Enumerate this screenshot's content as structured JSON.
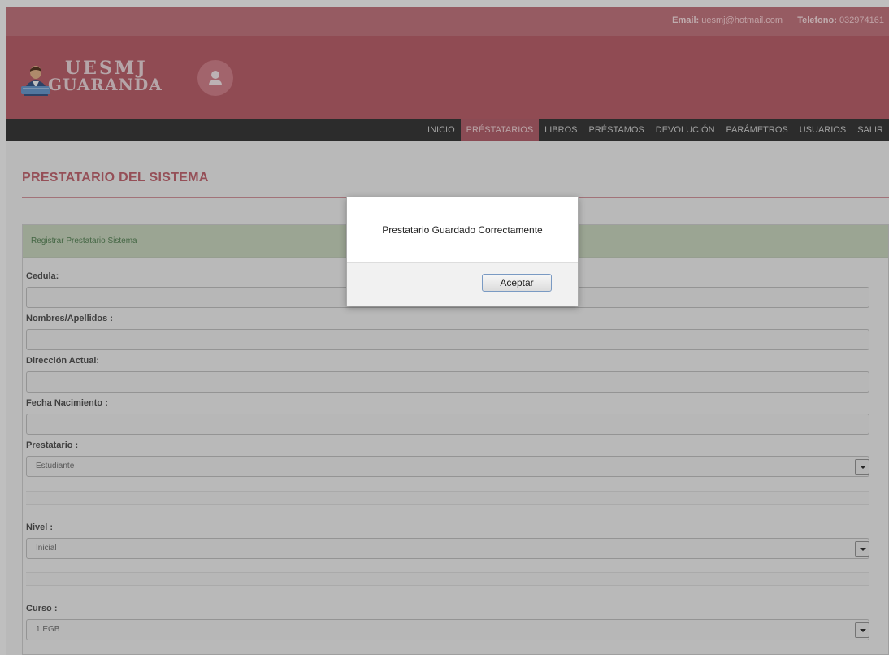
{
  "topbar": {
    "email_label": "Email:",
    "email": "uesmj@hotmail.com",
    "phone_label": "Telefono:",
    "phone": "032974161"
  },
  "brand": {
    "line1": "UESMJ",
    "line2": "GUARANDA"
  },
  "nav": {
    "items": [
      {
        "label": "INICIO"
      },
      {
        "label": "PRÉSTATARIOS"
      },
      {
        "label": "LIBROS"
      },
      {
        "label": "PRÉSTAMOS"
      },
      {
        "label": "DEVOLUCIÓN"
      },
      {
        "label": "PARÁMETROS"
      },
      {
        "label": "USUARIOS"
      },
      {
        "label": "SALIR"
      }
    ],
    "active": "PRÉSTATARIOS"
  },
  "page": {
    "title": "PRESTATARIO DEL SISTEMA"
  },
  "form": {
    "panel_title": "Registrar Prestatario Sistema",
    "cedula_label": "Cedula:",
    "cedula_value": "",
    "nombres_label": "Nombres/Apellidos :",
    "nombres_value": "",
    "direccion_label": "Dirección Actual:",
    "direccion_value": "",
    "fecha_label": "Fecha Nacimiento :",
    "fecha_value": "",
    "prestatario_label": "Prestatario :",
    "prestatario_value": "Estudiante",
    "nivel_label": "Nivel :",
    "nivel_value": "Inicial",
    "curso_label": "Curso :",
    "curso_value": "1 EGB"
  },
  "dialog": {
    "message": "Prestatario Guardado Correctamente",
    "accept_label": "Aceptar"
  },
  "colors": {
    "topbar": "#c97a83",
    "header": "#c0646f",
    "nav": "#3b3b3b",
    "accent": "#c76a75",
    "panel_head": "#cfdcc4"
  },
  "icons": {
    "logo": "librarian-person-icon",
    "user": "user-icon",
    "select": "chevron-down-icon"
  }
}
